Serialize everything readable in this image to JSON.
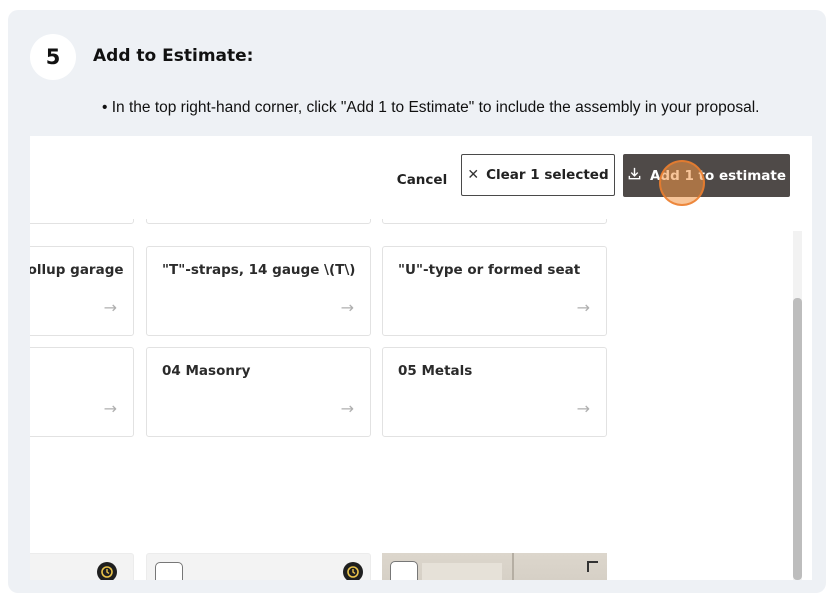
{
  "step": {
    "number": "5",
    "title": "Add to Estimate:",
    "instruction": "• In the top right-hand corner, click \"Add 1 to Estimate\" to include the assembly in your proposal."
  },
  "toolbar": {
    "cancel_label": "Cancel",
    "clear_label": "Clear 1 selected",
    "add_label": "Add 1 to estimate"
  },
  "tiles": [
    {
      "label": "rollup garage",
      "arrow": "→"
    },
    {
      "label": "\"T\"-straps, 14 gauge \\(T\\)",
      "arrow": "→"
    },
    {
      "label": "\"U\"-type or formed seat",
      "arrow": "→"
    },
    {
      "label": "",
      "arrow": "→"
    },
    {
      "label": "04 Masonry",
      "arrow": "→"
    },
    {
      "label": "05 Metals",
      "arrow": "→"
    }
  ],
  "icons": {
    "clear": "close-icon",
    "add": "download-icon",
    "recycle": "recycle-icon",
    "corner": "corner-mark-icon"
  },
  "colors": {
    "add_button": "#4f4a48",
    "click_highlight": "#f39646"
  }
}
